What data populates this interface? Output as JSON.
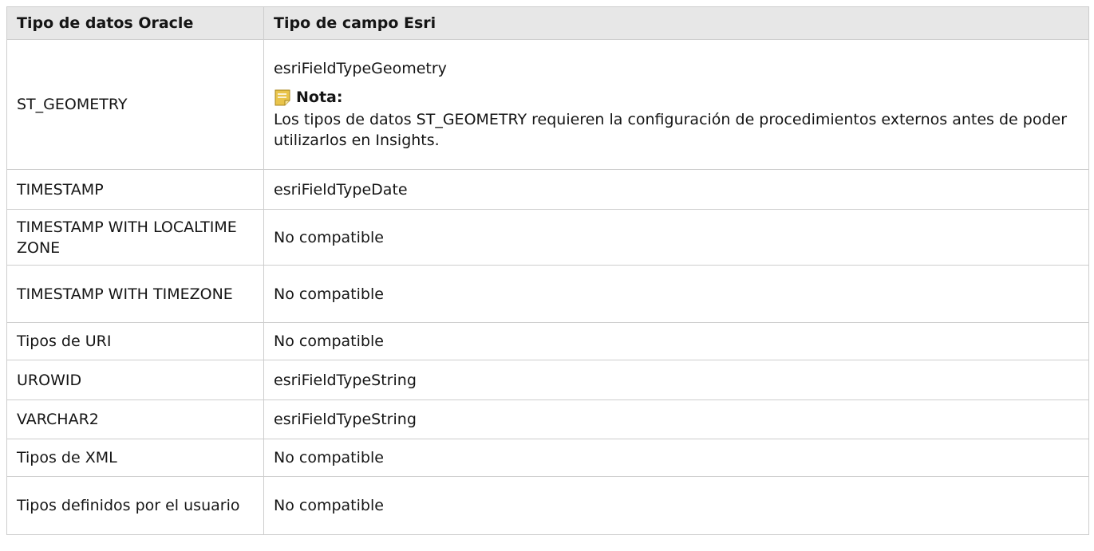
{
  "table": {
    "header": {
      "col1": "Tipo de datos Oracle",
      "col2": "Tipo de campo Esri"
    },
    "geometry_row": {
      "oracle_type": "ST_GEOMETRY",
      "esri_type": "esriFieldTypeGeometry",
      "note_icon": "note-icon",
      "note_label": "Nota:",
      "note_text": "Los tipos de datos ST_GEOMETRY requieren la configuración de procedimientos externos antes de poder utilizarlos en Insights."
    },
    "rows": [
      {
        "oracle_type": "TIMESTAMP",
        "esri_type": "esriFieldTypeDate"
      },
      {
        "oracle_type": "TIMESTAMP WITH LOCALTIME ZONE",
        "esri_type": "No compatible"
      },
      {
        "oracle_type": "TIMESTAMP WITH TIMEZONE",
        "esri_type": "No compatible"
      },
      {
        "oracle_type": "Tipos de URI",
        "esri_type": "No compatible"
      },
      {
        "oracle_type": "UROWID",
        "esri_type": "esriFieldTypeString"
      },
      {
        "oracle_type": "VARCHAR2",
        "esri_type": "esriFieldTypeString"
      },
      {
        "oracle_type": "Tipos de XML",
        "esri_type": "No compatible"
      },
      {
        "oracle_type": "Tipos definidos por el usuario",
        "esri_type": "No compatible"
      }
    ]
  },
  "colors": {
    "header_bg": "#e7e7e7",
    "border": "#cdcdcd",
    "text": "#151515",
    "note_icon_fill": "#e9c44b"
  }
}
